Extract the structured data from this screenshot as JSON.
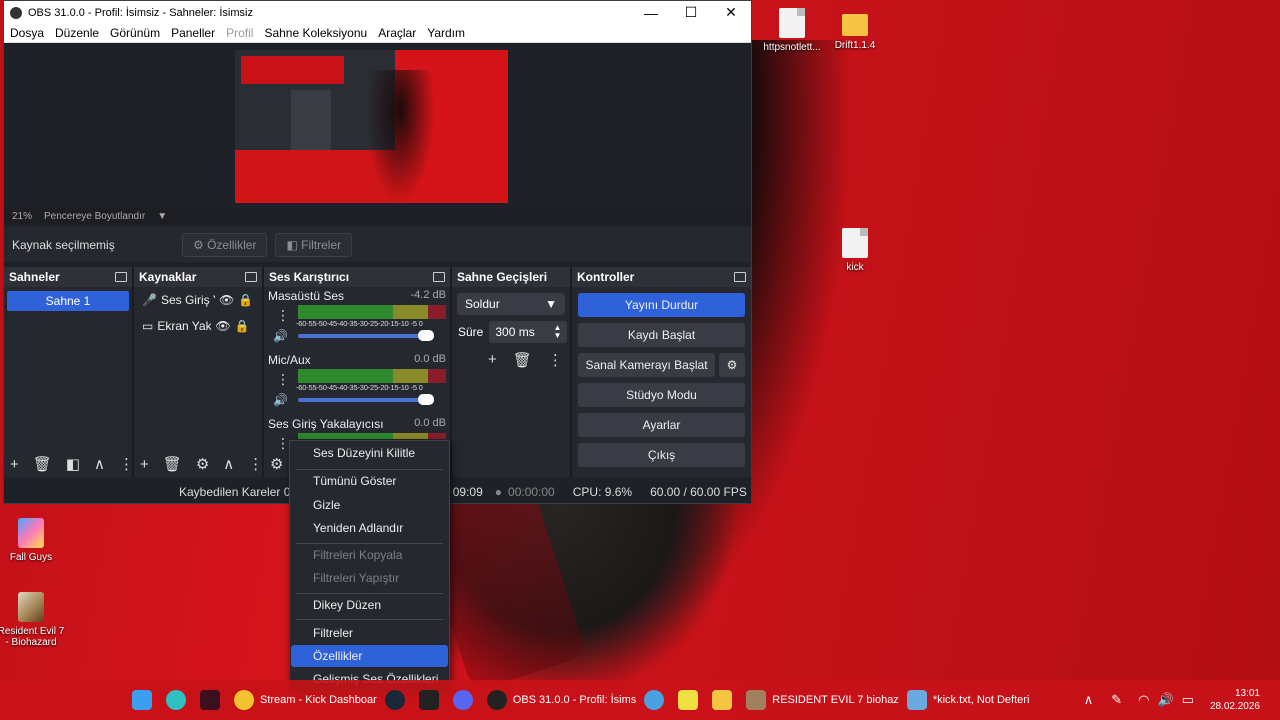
{
  "window": {
    "title": "OBS 31.0.0 - Profil: İsimsiz - Sahneler: İsimsiz",
    "minimize": "—",
    "maximize": "☐",
    "close": "✕"
  },
  "menu": [
    "Dosya",
    "Düzenle",
    "Görünüm",
    "Paneller",
    "Profil",
    "Sahne Koleksiyonu",
    "Araçlar",
    "Yardım"
  ],
  "preview": {
    "zoom": "21%",
    "fit_mode": "Pencereye Boyutlandır"
  },
  "source_bar": {
    "status": "Kaynak seçilmemiş",
    "properties": "Özellikler",
    "filters": "Filtreler"
  },
  "scenes": {
    "title": "Sahneler",
    "items": [
      "Sahne 1"
    ]
  },
  "sources": {
    "title": "Kaynaklar",
    "items": [
      "Ses Giriş Y",
      "Ekran Yaka"
    ]
  },
  "mixer": {
    "title": "Ses Karıştırıcı",
    "ticks": "-60-55-50-45-40-35-30-25-20-15-10 -5  0",
    "channels": [
      {
        "name": "Masaüstü Ses",
        "db": "-4.2 dB"
      },
      {
        "name": "Mic/Aux",
        "db": "0.0 dB"
      },
      {
        "name": "Ses Giriş Yakalayıcısı",
        "db": "0.0 dB"
      }
    ]
  },
  "transitions": {
    "title": "Sahne Geçişleri",
    "selected": "Soldur",
    "duration_label": "Süre",
    "duration": "300 ms"
  },
  "controls": {
    "title": "Kontroller",
    "buttons": [
      "Yayını Durdur",
      "Kaydı Başlat",
      "Sanal Kamerayı Başlat",
      "Stüdyo Modu",
      "Ayarlar",
      "Çıkış"
    ]
  },
  "status": {
    "dropped": "Kaybedilen Kareler 0 (",
    "stream_time": "09:09",
    "rec_time": "00:00:00",
    "cpu": "CPU: 9.6%",
    "fps": "60.00 / 60.00 FPS"
  },
  "context_menu": {
    "lock": "Ses Düzeyini Kilitle",
    "show_all": "Tümünü Göster",
    "hide": "Gizle",
    "rename": "Yeniden Adlandır",
    "copy_filters": "Filtreleri Kopyala",
    "paste_filters": "Filtreleri Yapıştır",
    "vertical": "Dikey Düzen",
    "filters": "Filtreler",
    "properties": "Özellikler",
    "advanced": "Gelişmiş Ses Özellikleri"
  },
  "desktop_icons": [
    "httpsnotlett...",
    "Drift1.1.4",
    "kick",
    "Fall Guys",
    "Resident Evil 7 - Biohazard"
  ],
  "taskbar": {
    "chrome": "Stream - Kick Dashboar",
    "obs": "OBS 31.0.0 - Profil: İsims",
    "re7": "RESIDENT EVIL 7 biohaz",
    "notepad": "*kick.txt, Not Defteri",
    "time": "13:01",
    "date": "28.02.2026"
  }
}
